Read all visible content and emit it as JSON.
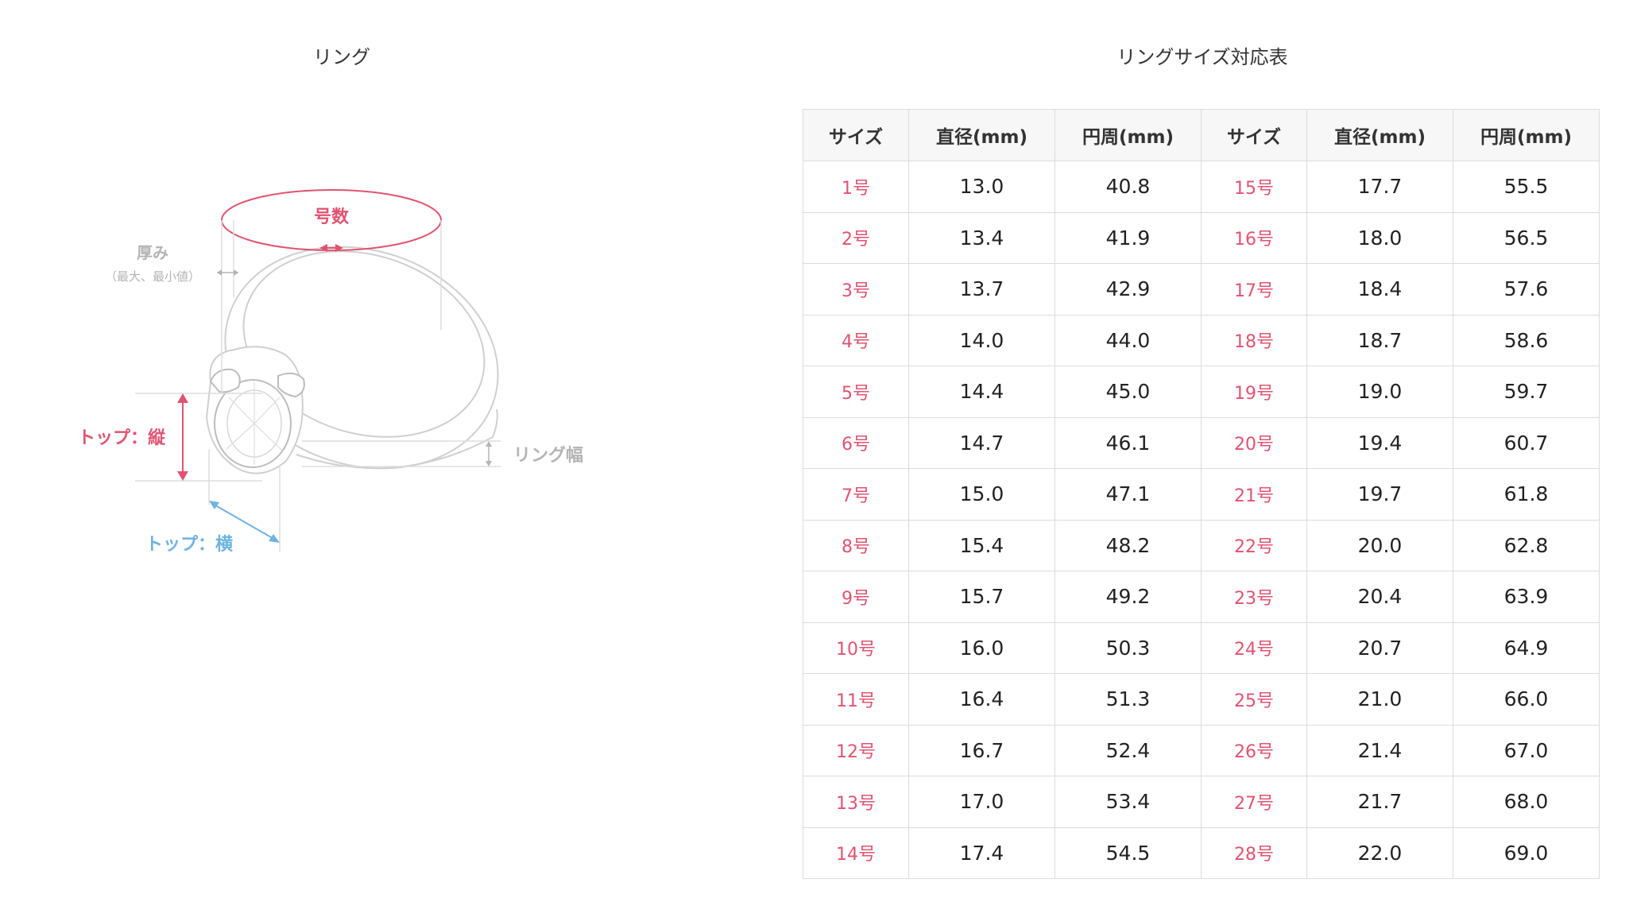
{
  "left_panel": {
    "title": "リング",
    "labels": {
      "size_number": "号数",
      "thickness": "厚み",
      "thickness_note": "（最大、最小値）",
      "top_vertical": "トップ：縦",
      "top_horizontal": "トップ：横",
      "ring_width": "リング幅"
    },
    "colors": {
      "pink": "#e05371",
      "blue": "#6fb3e0",
      "gray": "#b4b4b4",
      "line": "#cfcfcf"
    }
  },
  "right_panel": {
    "title": "リングサイズ対応表",
    "headers": [
      "サイズ",
      "直径(mm)",
      "円周(mm)",
      "サイズ",
      "直径(mm)",
      "円周(mm)"
    ],
    "rows": [
      [
        "1号",
        "13.0",
        "40.8",
        "15号",
        "17.7",
        "55.5"
      ],
      [
        "2号",
        "13.4",
        "41.9",
        "16号",
        "18.0",
        "56.5"
      ],
      [
        "3号",
        "13.7",
        "42.9",
        "17号",
        "18.4",
        "57.6"
      ],
      [
        "4号",
        "14.0",
        "44.0",
        "18号",
        "18.7",
        "58.6"
      ],
      [
        "5号",
        "14.4",
        "45.0",
        "19号",
        "19.0",
        "59.7"
      ],
      [
        "6号",
        "14.7",
        "46.1",
        "20号",
        "19.4",
        "60.7"
      ],
      [
        "7号",
        "15.0",
        "47.1",
        "21号",
        "19.7",
        "61.8"
      ],
      [
        "8号",
        "15.4",
        "48.2",
        "22号",
        "20.0",
        "62.8"
      ],
      [
        "9号",
        "15.7",
        "49.2",
        "23号",
        "20.4",
        "63.9"
      ],
      [
        "10号",
        "16.0",
        "50.3",
        "24号",
        "20.7",
        "64.9"
      ],
      [
        "11号",
        "16.4",
        "51.3",
        "25号",
        "21.0",
        "66.0"
      ],
      [
        "12号",
        "16.7",
        "52.4",
        "26号",
        "21.4",
        "67.0"
      ],
      [
        "13号",
        "17.0",
        "53.4",
        "27号",
        "21.7",
        "68.0"
      ],
      [
        "14号",
        "17.4",
        "54.5",
        "28号",
        "22.0",
        "69.0"
      ]
    ],
    "colors": {
      "size_text": "#e05371",
      "header_bg": "#f7f7f7",
      "border": "#dcdcdc"
    }
  }
}
